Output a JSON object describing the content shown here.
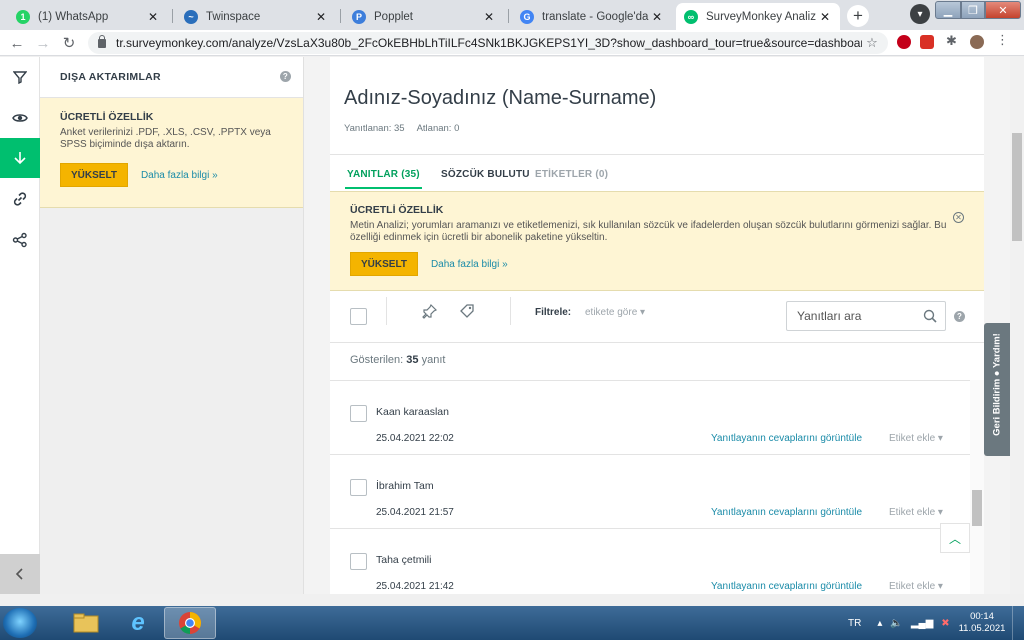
{
  "browser": {
    "tabs": [
      {
        "title": "(1) WhatsApp",
        "favicon_glyph": "1",
        "favicon_color": "#25d366",
        "icon": "whatsapp-icon"
      },
      {
        "title": "Twinspace",
        "favicon_glyph": "~",
        "favicon_color": "#2a6ebb",
        "icon": "twinspace-icon"
      },
      {
        "title": "Popplet",
        "favicon_glyph": "P",
        "favicon_color": "#3d7edb",
        "icon": "popplet-icon"
      },
      {
        "title": "translate - Google'da Ara",
        "favicon_glyph": "G",
        "favicon_color": "#4285f4",
        "icon": "google-icon"
      },
      {
        "title": "SurveyMonkey Analiz - Proje",
        "favicon_glyph": "∞",
        "favicon_color": "#00bf6f",
        "icon": "surveymonkey-icon"
      }
    ],
    "url": "tr.surveymonkey.com/analyze/VzsLaX3u80b_2FcOkEBHbLhTiILFc4SNk1BKJGKEPS1YI_3D?show_dashboard_tour=true&source=dashboard_list"
  },
  "sidebar": {
    "title": "DIŞA AKTARIMLAR",
    "help": "?",
    "promo": {
      "title": "ÜCRETLİ ÖZELLİK",
      "text": "Anket verilerinizi .PDF, .XLS, .CSV, .PPTX veya SPSS biçiminde dışa aktarın.",
      "button": "YÜKSELT",
      "link": "Daha fazla bilgi »"
    }
  },
  "survey": {
    "title": "Adınız-Soyadınız (Name-Surname)",
    "answered_label": "Yanıtlanan: 35",
    "skipped_label": "Atlanan: 0"
  },
  "tabs": [
    {
      "label": "YANITLAR (35)"
    },
    {
      "label": "SÖZCÜK BULUTU"
    },
    {
      "label": "ETİKETLER (0)"
    }
  ],
  "banner": {
    "title": "ÜCRETLİ ÖZELLİK",
    "text": "Metin Analizi; yorumları aramanızı ve etiketlemenizi, sık kullanılan sözcük ve ifadelerden oluşan sözcük bulutlarını görmenizi sağlar. Bu özelliği edinmek için ücretli bir abonelik paketine yükseltin.",
    "button": "YÜKSELT",
    "link": "Daha fazla bilgi »"
  },
  "filter": {
    "label": "Filtrele:",
    "select": "etikete göre",
    "search_placeholder": "Yanıtları ara",
    "help": "?"
  },
  "list": {
    "shown_prefix": "Gösterilen:",
    "shown_count": "35",
    "shown_suffix": "yanıt",
    "responses": [
      {
        "name": "Kaan karaaslan",
        "date": "25.04.2021 22:02",
        "link": "Yanıtlayanın cevaplarını görüntüle",
        "tag": "Etiket ekle"
      },
      {
        "name": "İbrahim Tam",
        "date": "25.04.2021 21:57",
        "link": "Yanıtlayanın cevaplarını görüntüle",
        "tag": "Etiket ekle"
      },
      {
        "name": "Taha çetmili",
        "date": "25.04.2021 21:42",
        "link": "Yanıtlayanın cevaplarını görüntüle",
        "tag": "Etiket ekle"
      }
    ]
  },
  "feedback": {
    "label": "Geri Bildirim  ● Yardım!"
  },
  "taskbar": {
    "language": "TR",
    "time": "00:14",
    "date": "11.05.2021"
  },
  "colors": {
    "brand": "#00bf6f",
    "upgrade": "#f4b400",
    "link": "#1a8ba8",
    "promo_bg": "#fef5d4"
  }
}
